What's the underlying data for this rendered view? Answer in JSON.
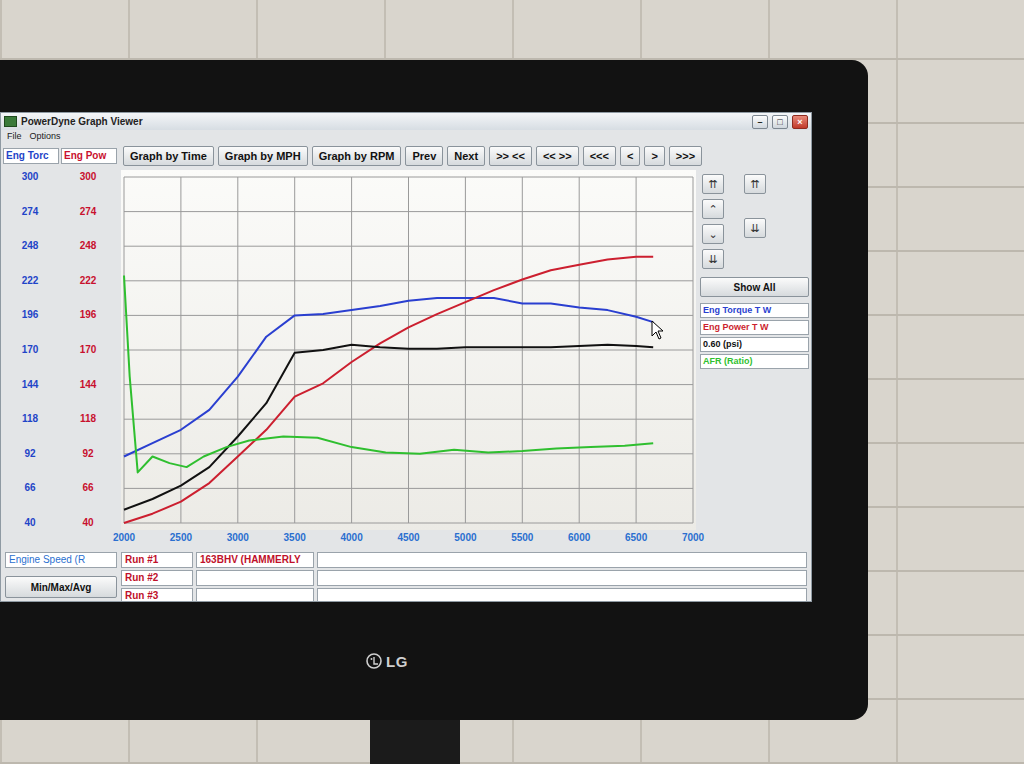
{
  "window": {
    "title": "PowerDyne Graph Viewer",
    "controls": [
      "–",
      "□",
      "×"
    ]
  },
  "menu": [
    "File",
    "Options"
  ],
  "axis_headers": [
    {
      "label": "Eng Torc",
      "color": "#1f44c8"
    },
    {
      "label": "Eng Pow",
      "color": "#c8102e"
    }
  ],
  "toolbar": [
    "Graph by Time",
    "Graph by MPH",
    "Graph by RPM",
    "Prev",
    "Next",
    ">> <<",
    "<< >>",
    "<<<",
    "<",
    ">",
    ">>>"
  ],
  "y_ticks_torque": [
    "300",
    "274",
    "248",
    "222",
    "196",
    "170",
    "144",
    "118",
    "92",
    "66",
    "40"
  ],
  "y_ticks_power": [
    "300",
    "274",
    "248",
    "222",
    "196",
    "170",
    "144",
    "118",
    "92",
    "66",
    "40"
  ],
  "x_ticks": [
    "2000",
    "2500",
    "3000",
    "3500",
    "4000",
    "4500",
    "5000",
    "5500",
    "6000",
    "6500",
    "7000"
  ],
  "scroll_buttons": {
    "left": [
      "⇈",
      "⌃",
      "⌄",
      "⇊"
    ],
    "right": [
      "⇈",
      "⇊"
    ]
  },
  "show_all": "Show All",
  "series": [
    {
      "name": "Eng Torque T W",
      "color": "#2a3fd0",
      "rpm": [
        2000,
        2250,
        2500,
        2750,
        3000,
        3250,
        3500,
        3750,
        4000,
        4250,
        4500,
        4750,
        5000,
        5250,
        5500,
        5750,
        6000,
        6250,
        6500,
        6650
      ],
      "values": [
        90,
        100,
        110,
        125,
        150,
        180,
        196,
        197,
        200,
        203,
        207,
        209,
        209,
        209,
        205,
        205,
        202,
        200,
        195,
        191
      ]
    },
    {
      "name": "Eng Power T W",
      "color": "#cc1f2f",
      "rpm": [
        2000,
        2250,
        2500,
        2750,
        3000,
        3250,
        3500,
        3750,
        4000,
        4250,
        4500,
        4750,
        5000,
        5250,
        5500,
        5750,
        6000,
        6250,
        6500,
        6650
      ],
      "values": [
        40,
        47,
        56,
        70,
        90,
        110,
        135,
        145,
        161,
        175,
        187,
        197,
        206,
        215,
        223,
        230,
        234,
        238,
        240,
        240
      ]
    },
    {
      "name": "0.60 (psi)",
      "color": "#111111",
      "rpm": [
        2000,
        2250,
        2500,
        2750,
        3000,
        3250,
        3500,
        3750,
        4000,
        4250,
        4500,
        4750,
        5000,
        5250,
        5500,
        5750,
        6000,
        6250,
        6500,
        6650
      ],
      "values": [
        50,
        58,
        68,
        82,
        105,
        130,
        168,
        170,
        174,
        172,
        171,
        171,
        172,
        172,
        172,
        172,
        173,
        174,
        173,
        172
      ]
    },
    {
      "name": "AFR (Ratio)",
      "color": "#2fbf2f",
      "rpm": [
        2000,
        2050,
        2120,
        2250,
        2400,
        2550,
        2700,
        2900,
        3100,
        3400,
        3700,
        4000,
        4300,
        4600,
        4900,
        5200,
        5500,
        5800,
        6100,
        6400,
        6650
      ],
      "values": [
        226,
        150,
        78,
        90,
        85,
        82,
        90,
        97,
        102,
        105,
        104,
        97,
        93,
        92,
        95,
        93,
        94,
        96,
        97,
        98,
        100
      ]
    }
  ],
  "x_axis_label": "Engine Speed (R",
  "runs": [
    {
      "label": "Run #1",
      "value": "163BHV (HAMMERLY"
    },
    {
      "label": "Run #2",
      "value": ""
    },
    {
      "label": "Run #3",
      "value": ""
    }
  ],
  "min_max_avg": "Min/Max/Avg",
  "monitor": {
    "brand": "LG"
  }
}
